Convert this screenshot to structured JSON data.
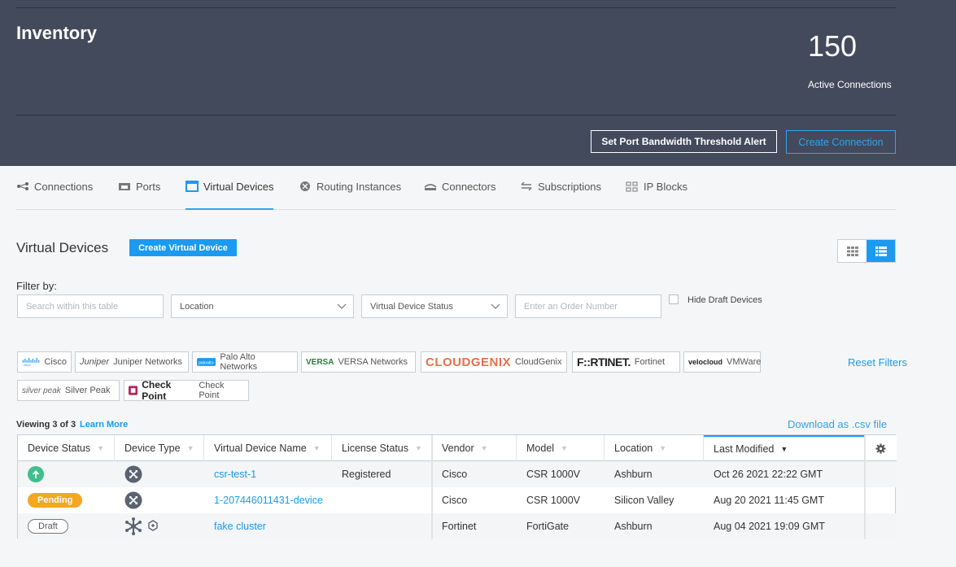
{
  "header": {
    "title": "Inventory",
    "active_count": "150",
    "active_label": "Active Connections",
    "threshold_btn": "Set Port Bandwidth Threshold Alert",
    "create_conn_btn": "Create Connection"
  },
  "tabs": [
    {
      "label": "Connections",
      "icon": "connections-icon"
    },
    {
      "label": "Ports",
      "icon": "port-icon"
    },
    {
      "label": "Virtual Devices",
      "icon": "window-icon",
      "active": true
    },
    {
      "label": "Routing Instances",
      "icon": "router-icon"
    },
    {
      "label": "Connectors",
      "icon": "connector-icon"
    },
    {
      "label": "Subscriptions",
      "icon": "arrows-icon"
    },
    {
      "label": "IP Blocks",
      "icon": "blocks-icon"
    }
  ],
  "section": {
    "title": "Virtual Devices",
    "create_btn": "Create Virtual Device"
  },
  "filters": {
    "label": "Filter by:",
    "search_placeholder": "Search within this table",
    "location": "Location",
    "status": "Virtual Device Status",
    "order_placeholder": "Enter an Order Number",
    "hide_draft": "Hide Draft Devices"
  },
  "vendors": [
    {
      "logo": "cisco",
      "label": "Cisco"
    },
    {
      "logo": "Juniper",
      "label": "Juniper Networks"
    },
    {
      "logo": "paloalto",
      "label": "Palo Alto Networks"
    },
    {
      "logo": "VERSA",
      "label": "VERSA Networks"
    },
    {
      "logo": "CLOUDGENIX",
      "label": "CloudGenix"
    },
    {
      "logo": "F::RTINET.",
      "label": "Fortinet"
    },
    {
      "logo": "velocloud",
      "label": "VMWare"
    },
    {
      "logo": "silver peak",
      "label": "Silver Peak"
    },
    {
      "logo": "Check Point",
      "label": "Check Point"
    }
  ],
  "reset_filters": "Reset Filters",
  "viewing": "Viewing 3 of 3",
  "learn_more": "Learn More",
  "download": "Download as .csv file",
  "table": {
    "columns": [
      "Device Status",
      "Device Type",
      "Virtual Device Name",
      "License Status",
      "Vendor",
      "Model",
      "Location",
      "Last Modified"
    ],
    "rows": [
      {
        "status": "up",
        "status_text": "",
        "name": "csr-test-1",
        "license": "Registered",
        "vendor": "Cisco",
        "model": "CSR 1000V",
        "location": "Ashburn",
        "modified": "Oct 26 2021 22:22 GMT"
      },
      {
        "status": "pending",
        "status_text": "Pending",
        "name": "1-207446011431-device",
        "license": "",
        "vendor": "Cisco",
        "model": "CSR 1000V",
        "location": "Silicon Valley",
        "modified": "Aug 20 2021 11:45 GMT"
      },
      {
        "status": "draft",
        "status_text": "Draft",
        "name": "fake cluster",
        "license": "",
        "vendor": "Fortinet",
        "model": "FortiGate",
        "location": "Ashburn",
        "modified": "Aug 04 2021 19:09 GMT"
      }
    ]
  },
  "colors": {
    "accent": "#1a9af0",
    "header_bg": "#434a5b",
    "pending": "#f5a623",
    "up": "#3fbf8a"
  }
}
